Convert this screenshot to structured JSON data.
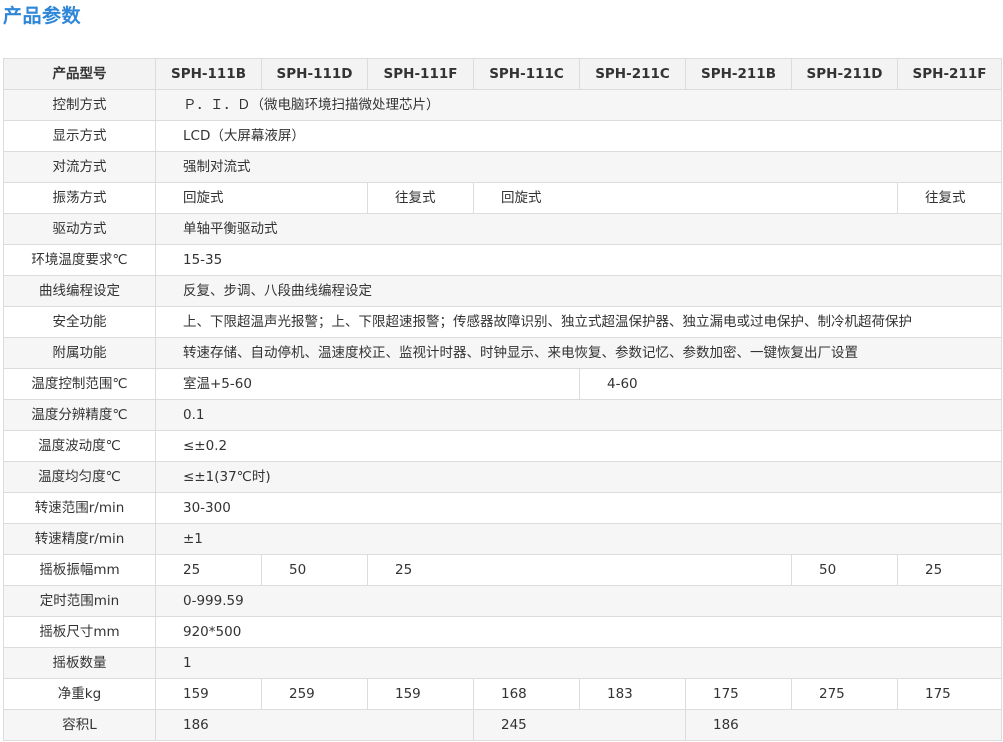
{
  "page": {
    "title": "产品参数"
  },
  "table": {
    "header_label": "产品型号",
    "models": [
      "SPH-111B",
      "SPH-111D",
      "SPH-111F",
      "SPH-111C",
      "SPH-211C",
      "SPH-211B",
      "SPH-211D",
      "SPH-211F"
    ],
    "rows": [
      {
        "label": "控制方式",
        "cells": [
          {
            "text": "Ｐ．Ｉ．Ｄ（微电脑环境扫描微处理芯片）",
            "span": 8
          }
        ]
      },
      {
        "label": "显示方式",
        "cells": [
          {
            "text": "LCD（大屏幕液屏）",
            "span": 8
          }
        ]
      },
      {
        "label": "对流方式",
        "cells": [
          {
            "text": "强制对流式",
            "span": 8
          }
        ]
      },
      {
        "label": "振荡方式",
        "cells": [
          {
            "text": "回旋式",
            "span": 2
          },
          {
            "text": "往复式",
            "span": 1
          },
          {
            "text": "回旋式",
            "span": 4
          },
          {
            "text": "往复式",
            "span": 1
          }
        ]
      },
      {
        "label": "驱动方式",
        "cells": [
          {
            "text": "单轴平衡驱动式",
            "span": 8
          }
        ]
      },
      {
        "label": "环境温度要求℃",
        "cells": [
          {
            "text": "15-35",
            "span": 8
          }
        ]
      },
      {
        "label": "曲线编程设定",
        "cells": [
          {
            "text": "反复、步调、八段曲线编程设定",
            "span": 8
          }
        ]
      },
      {
        "label": "安全功能",
        "cells": [
          {
            "text": "上、下限超温声光报警；上、下限超速报警；传感器故障识别、独立式超温保护器、独立漏电或过电保护、制冷机超荷保护",
            "span": 8
          }
        ]
      },
      {
        "label": "附属功能",
        "cells": [
          {
            "text": "转速存储、自动停机、温速度校正、监视计时器、时钟显示、来电恢复、参数记忆、参数加密、一键恢复出厂设置",
            "span": 8
          }
        ]
      },
      {
        "label": "温度控制范围℃",
        "cells": [
          {
            "text": "室温+5-60",
            "span": 4
          },
          {
            "text": "4-60",
            "span": 4
          }
        ]
      },
      {
        "label": "温度分辨精度℃",
        "cells": [
          {
            "text": "0.1",
            "span": 8
          }
        ]
      },
      {
        "label": "温度波动度℃",
        "cells": [
          {
            "text": "≤±0.2",
            "span": 8
          }
        ]
      },
      {
        "label": "温度均匀度℃",
        "cells": [
          {
            "text": "≤±1(37℃时)",
            "span": 8
          }
        ]
      },
      {
        "label": "转速范围r/min",
        "cells": [
          {
            "text": "30-300",
            "span": 8
          }
        ]
      },
      {
        "label": "转速精度r/min",
        "cells": [
          {
            "text": "±1",
            "span": 8
          }
        ]
      },
      {
        "label": "摇板振幅mm",
        "cells": [
          {
            "text": "25",
            "span": 1
          },
          {
            "text": "50",
            "span": 1
          },
          {
            "text": "25",
            "span": 4
          },
          {
            "text": "50",
            "span": 1
          },
          {
            "text": "25",
            "span": 1
          }
        ]
      },
      {
        "label": "定时范围min",
        "cells": [
          {
            "text": "0-999.59",
            "span": 8
          }
        ]
      },
      {
        "label": "摇板尺寸mm",
        "cells": [
          {
            "text": "920*500",
            "span": 8
          }
        ]
      },
      {
        "label": "摇板数量",
        "cells": [
          {
            "text": "1",
            "span": 8
          }
        ]
      },
      {
        "label": "净重kg",
        "cells": [
          {
            "text": "159",
            "span": 1
          },
          {
            "text": "259",
            "span": 1
          },
          {
            "text": "159",
            "span": 1
          },
          {
            "text": "168",
            "span": 1
          },
          {
            "text": "183",
            "span": 1
          },
          {
            "text": "175",
            "span": 1
          },
          {
            "text": "275",
            "span": 1
          },
          {
            "text": "175",
            "span": 1
          }
        ]
      },
      {
        "label": "容积L",
        "cells": [
          {
            "text": "186",
            "span": 3
          },
          {
            "text": "245",
            "span": 2
          },
          {
            "text": "186",
            "span": 3
          }
        ]
      }
    ]
  }
}
